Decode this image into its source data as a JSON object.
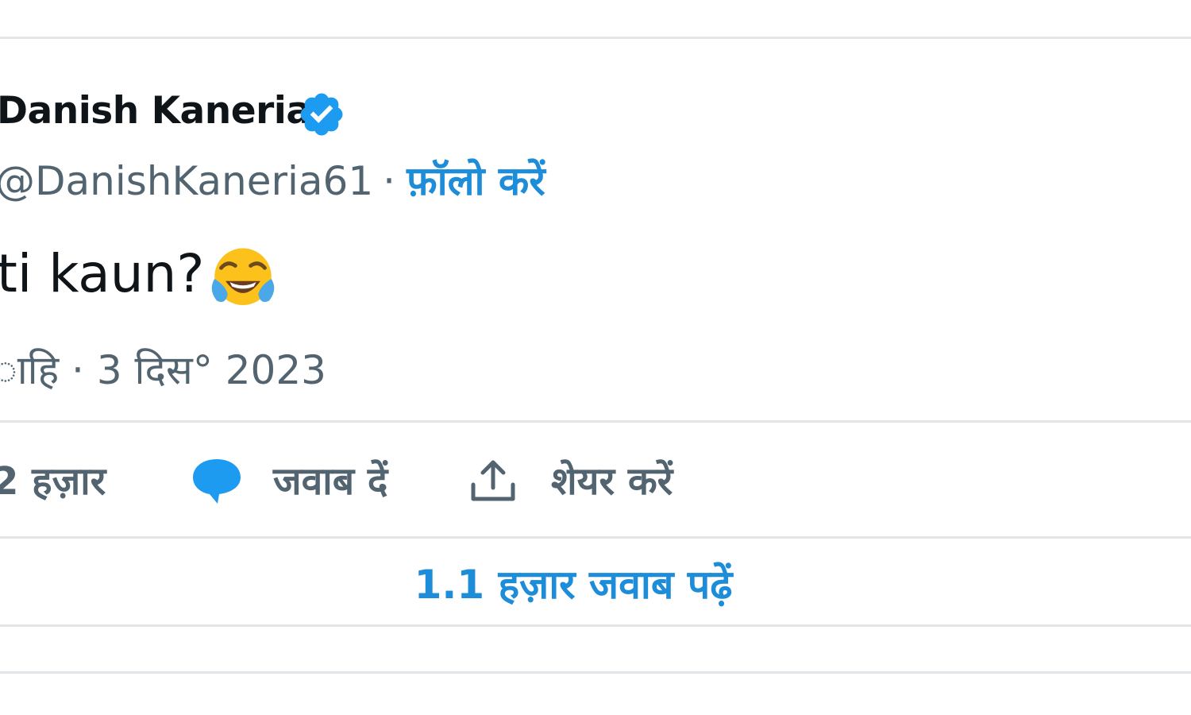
{
  "tweet": {
    "author_name": "Danish Kaneria",
    "verified_icon": "verified-badge-icon",
    "handle": "@DanishKaneria61",
    "separator": "·",
    "follow_label": "फ़ॉलो करें",
    "text": "ti kaun?",
    "emoji": "face-with-tears-of-joy",
    "meta": "ाहि · 3 दिस° 2023"
  },
  "actions": {
    "likes": "2 हज़ार",
    "reply_icon": "speech-bubble-icon",
    "reply_label": "जवाब दें",
    "share_icon": "share-upload-icon",
    "share_label": "शेयर करें"
  },
  "footer": {
    "read_replies_label": "1.1 हज़ार जवाब पढ़ें"
  },
  "colors": {
    "accent": "#1d8cd9",
    "muted": "#536471",
    "text": "#0f1419",
    "divider": "#e3e6e8"
  }
}
